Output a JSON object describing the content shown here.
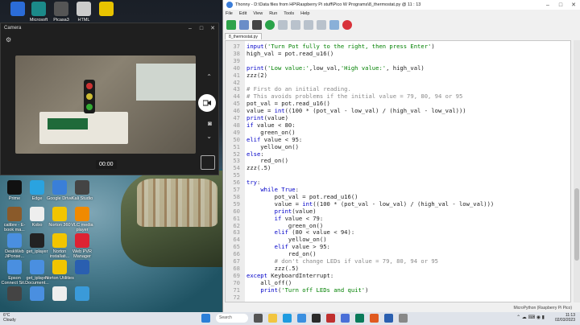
{
  "desktop": {
    "icons_top": [
      {
        "label": "",
        "icon": "app-icon",
        "color": "#2b6cd8"
      },
      {
        "label": "Microsoft Sway",
        "icon": "sway-icon",
        "color": "#1b8a89"
      },
      {
        "label": "Picasa3",
        "icon": "picasa-icon",
        "color": "#555"
      },
      {
        "label": "HTML",
        "icon": "orb-icon",
        "color": "#ccc"
      },
      {
        "label": "",
        "icon": "ball-icon",
        "color": "#e8c300"
      }
    ],
    "icons_grid": [
      {
        "label": "Prime",
        "icon": "prime-icon",
        "color": "#111"
      },
      {
        "label": "Edge",
        "icon": "edge-icon",
        "color": "#2aa3e0"
      },
      {
        "label": "Google Drive",
        "icon": "drive-icon",
        "color": "#3a7fd8"
      },
      {
        "label": "Kali Studio",
        "icon": "gear-app-icon",
        "color": "#444"
      },
      {
        "label": "calibre - E-book ma...",
        "icon": "calibre-icon",
        "color": "#8a5a2a"
      },
      {
        "label": "Kobo",
        "icon": "doc-icon",
        "color": "#eee"
      },
      {
        "label": "Norton 360",
        "icon": "norton-icon",
        "color": "#f2c500"
      },
      {
        "label": "VLC media player",
        "icon": "vlc-icon",
        "color": "#f08a00"
      },
      {
        "label": "DeskWeb JiPonse...",
        "icon": "chrome-icon",
        "color": "#4a8fe0"
      },
      {
        "label": "get_iplayer",
        "icon": "iplayer-icon",
        "color": "#222"
      },
      {
        "label": "Norton installati...",
        "icon": "norton2-icon",
        "color": "#f2c500"
      },
      {
        "label": "Web PVR Manager",
        "icon": "pvr-icon",
        "color": "#d23"
      },
      {
        "label": "Epson Connect Sit...",
        "icon": "chrome-icon",
        "color": "#4a8fe0"
      },
      {
        "label": "get_iplayer Document...",
        "icon": "chrome-icon",
        "color": "#4a8fe0"
      },
      {
        "label": "Norton Utilities",
        "icon": "norton3-icon",
        "color": "#f2c500"
      },
      {
        "label": "",
        "icon": "app-icon",
        "color": "#2a5fb0"
      },
      {
        "label": "",
        "icon": "app-icon",
        "color": "#444"
      },
      {
        "label": "",
        "icon": "chrome-icon",
        "color": "#4a8fe0"
      },
      {
        "label": "",
        "icon": "file-icon",
        "color": "#eee"
      },
      {
        "label": "",
        "icon": "app-icon",
        "color": "#3a9ad9"
      }
    ]
  },
  "camera": {
    "title": "Camera",
    "timer": "00:00"
  },
  "thonny": {
    "title": "Thonny - D:\\Data files from HP\\Raspberry Pi stuff\\Pico W Programs\\8_thermostat.py @ 11 : 13",
    "menu": [
      "File",
      "Edit",
      "View",
      "Run",
      "Tools",
      "Help"
    ],
    "tab": "8_thermostat.py",
    "status": "MicroPython (Raspberry Pi Pico)",
    "code": [
      {
        "n": "37",
        "text": "input('Turn Pot fully to the right, then press Enter')",
        "kind": "code"
      },
      {
        "n": "38",
        "text": "high_val = pot.read_u16()",
        "kind": "code"
      },
      {
        "n": "39",
        "text": "",
        "kind": "code"
      },
      {
        "n": "40",
        "text": "print('Low value:',low_val,'High value:', high_val)",
        "kind": "code"
      },
      {
        "n": "41",
        "text": "zzz(2)",
        "kind": "code"
      },
      {
        "n": "42",
        "text": "",
        "kind": "code"
      },
      {
        "n": "43",
        "text": "# First do an initial reading.",
        "kind": "comment"
      },
      {
        "n": "44",
        "text": "# This avoids problems if the initial value = 79, 80, 94 or 95",
        "kind": "comment"
      },
      {
        "n": "45",
        "text": "pot_val = pot.read_u16()",
        "kind": "code"
      },
      {
        "n": "46",
        "text": "value = int((100 * (pot_val - low_val) / (high_val - low_val)))",
        "kind": "code"
      },
      {
        "n": "47",
        "text": "print(value)",
        "kind": "code"
      },
      {
        "n": "48",
        "text": "if value < 80:",
        "kind": "code"
      },
      {
        "n": "49",
        "text": "    green_on()",
        "kind": "code"
      },
      {
        "n": "50",
        "text": "elif value < 95:",
        "kind": "code"
      },
      {
        "n": "51",
        "text": "    yellow_on()",
        "kind": "code"
      },
      {
        "n": "52",
        "text": "else:",
        "kind": "code"
      },
      {
        "n": "53",
        "text": "    red_on()",
        "kind": "code"
      },
      {
        "n": "54",
        "text": "zzz(.5)",
        "kind": "code"
      },
      {
        "n": "55",
        "text": "",
        "kind": "code"
      },
      {
        "n": "56",
        "text": "try:",
        "kind": "code"
      },
      {
        "n": "57",
        "text": "    while True:",
        "kind": "code"
      },
      {
        "n": "58",
        "text": "        pot_val = pot.read_u16()",
        "kind": "code"
      },
      {
        "n": "59",
        "text": "        value = int((100 * (pot_val - low_val) / (high_val - low_val)))",
        "kind": "code"
      },
      {
        "n": "60",
        "text": "        print(value)",
        "kind": "code"
      },
      {
        "n": "61",
        "text": "        if value < 79:",
        "kind": "code"
      },
      {
        "n": "62",
        "text": "            green_on()",
        "kind": "code"
      },
      {
        "n": "63",
        "text": "        elif (80 < value < 94):",
        "kind": "code"
      },
      {
        "n": "64",
        "text": "            yellow_on()",
        "kind": "code"
      },
      {
        "n": "65",
        "text": "        elif value > 95:",
        "kind": "code"
      },
      {
        "n": "66",
        "text": "            red_on()",
        "kind": "code"
      },
      {
        "n": "67",
        "text": "        # don't change LEDs if value = 79, 80, 94 or 95",
        "kind": "comment"
      },
      {
        "n": "68",
        "text": "        zzz(.5)",
        "kind": "code"
      },
      {
        "n": "69",
        "text": "except KeyboardInterrupt:",
        "kind": "code"
      },
      {
        "n": "70",
        "text": "    all_off()",
        "kind": "code"
      },
      {
        "n": "71",
        "text": "    print('Turn off LEDs and quit')",
        "kind": "code"
      },
      {
        "n": "72",
        "text": "",
        "kind": "code"
      }
    ]
  },
  "taskbar": {
    "weather_temp": "6°C",
    "weather_desc": "Cloudy",
    "search_placeholder": "Search",
    "time": "11:13",
    "date": "02/03/2023"
  },
  "colors": {
    "keyword": "#0000c8",
    "string": "#008000",
    "comment": "#8a8a8a",
    "number": "#0a7a7a"
  }
}
